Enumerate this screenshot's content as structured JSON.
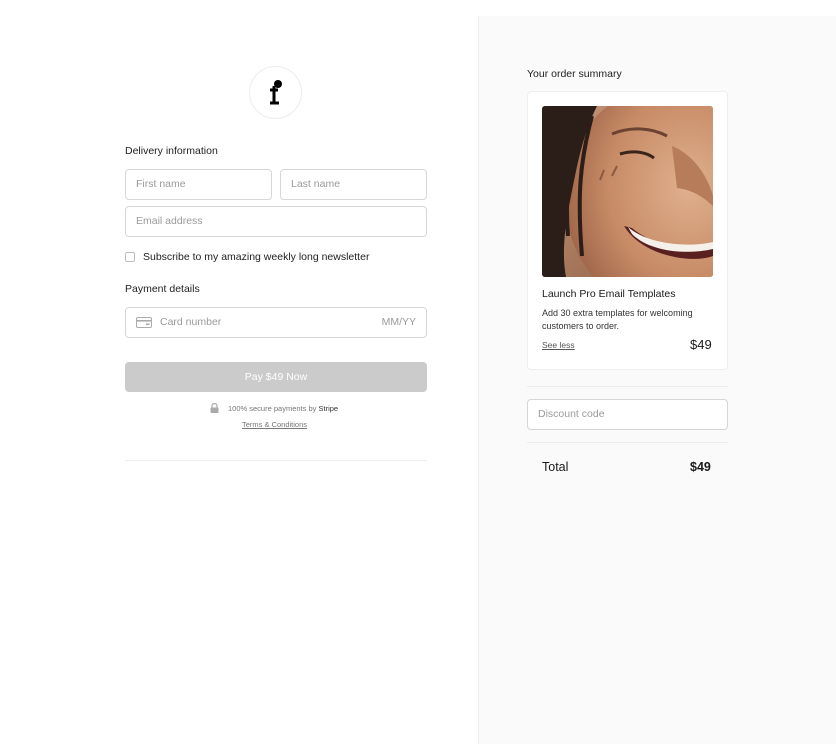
{
  "brand": {
    "logo_letter": "f"
  },
  "delivery": {
    "heading": "Delivery information",
    "first_name_placeholder": "First name",
    "last_name_placeholder": "Last name",
    "email_placeholder": "Email address",
    "newsletter_label": "Subscribe to my amazing weekly long newsletter",
    "newsletter_checked": false
  },
  "payment": {
    "heading": "Payment details",
    "card_placeholder": "Card number",
    "expiry_placeholder": "MM/YY",
    "pay_button": "Pay $49 Now",
    "secure_text": "100% secure payments by",
    "secure_provider": "Stripe",
    "terms_link": "Terms & Conditions"
  },
  "summary": {
    "heading": "Your order summary",
    "product": {
      "name": "Launch Pro Email Templates",
      "description": "Add 30 extra templates for welcoming customers to order.",
      "see_less": "See less",
      "price": "$49"
    },
    "discount_placeholder": "Discount code",
    "total_label": "Total",
    "total_value": "$49"
  },
  "colors": {
    "button_disabled": "#cbcbcb",
    "border": "#d6d6d6",
    "panel_bg": "#fafafa"
  },
  "icons": [
    "brand-logo-icon",
    "credit-card-icon",
    "lock-icon",
    "checkbox"
  ]
}
